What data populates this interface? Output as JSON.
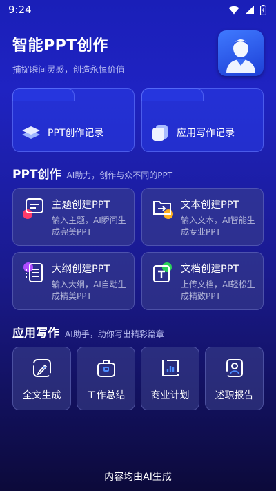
{
  "status": {
    "time": "9:24"
  },
  "header": {
    "title": "智能PPT创作",
    "subtitle": "捕捉瞬间灵感，创造永恒价值"
  },
  "records": [
    {
      "label": "PPT创作记录",
      "icon": "layers-icon"
    },
    {
      "label": "应用写作记录",
      "icon": "stacked-cards-icon"
    }
  ],
  "ppt_section": {
    "title": "PPT创作",
    "description": "AI助力，创作与众不同的PPT",
    "cards": [
      {
        "title": "主题创建PPT",
        "subtitle": "输入主题，AI瞬间生成完美PPT",
        "icon": "chat-topic-icon",
        "accent": "#ff3b6b"
      },
      {
        "title": "文本创建PPT",
        "subtitle": "输入文本，AI智能生成专业PPT",
        "icon": "folder-arrow-icon",
        "accent": "#ffb020"
      },
      {
        "title": "大纲创建PPT",
        "subtitle": "输入大纲，AI自动生成精美PPT",
        "icon": "outline-list-icon",
        "accent": "#b04bff"
      },
      {
        "title": "文档创建PPT",
        "subtitle": "上传文档，AI轻松生成精致PPT",
        "icon": "text-document-icon",
        "accent": "#2bd15a"
      }
    ]
  },
  "writing_section": {
    "title": "应用写作",
    "description": "AI助手，助你写出精彩篇章",
    "items": [
      {
        "label": "全文生成",
        "icon": "pen-document-icon"
      },
      {
        "label": "工作总结",
        "icon": "briefcase-icon"
      },
      {
        "label": "商业计划",
        "icon": "bar-chart-icon"
      },
      {
        "label": "述职报告",
        "icon": "person-report-icon"
      }
    ]
  },
  "footer": {
    "note": "内容均由AI生成"
  }
}
